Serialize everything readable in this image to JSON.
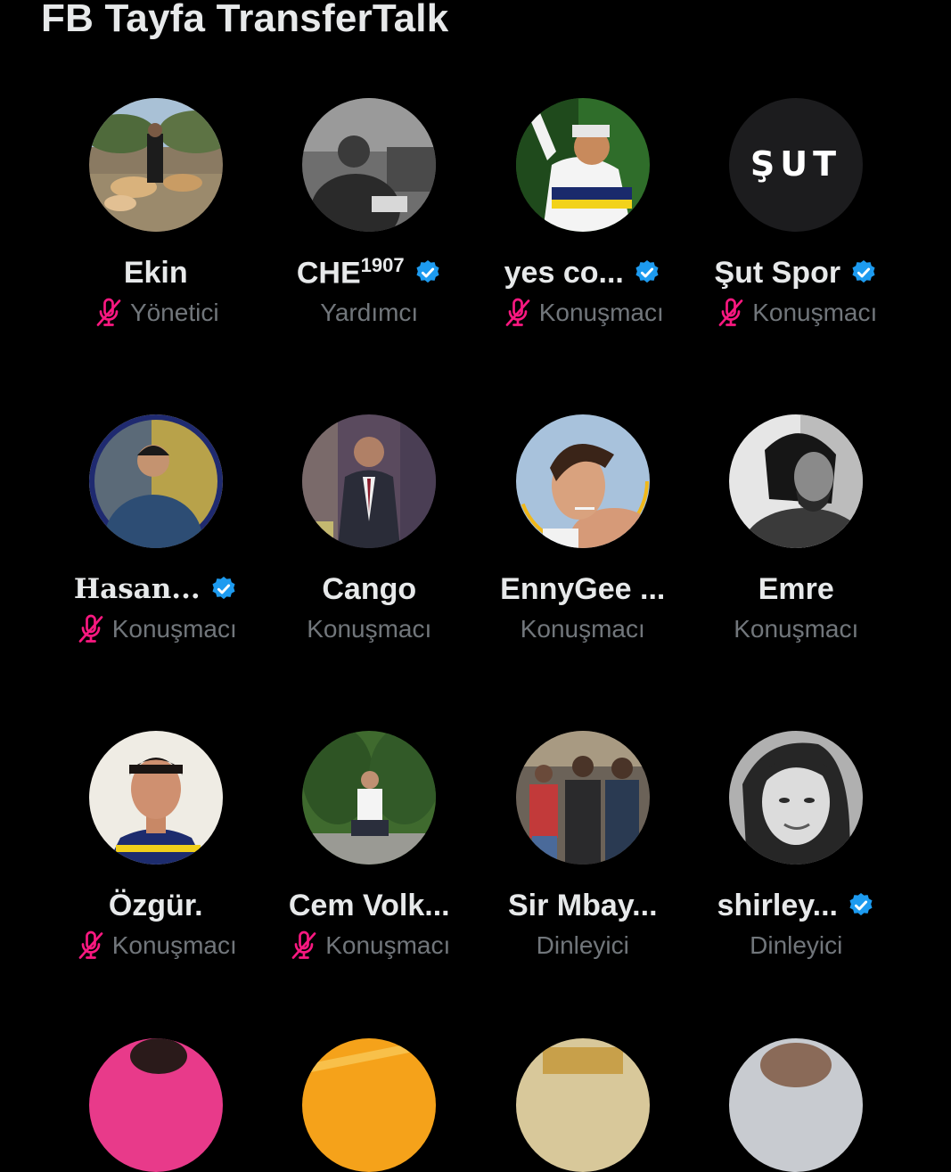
{
  "space": {
    "title": "FB Tayfa TransferTalk"
  },
  "participants": [
    {
      "name": "Ekin",
      "verified": false,
      "muted": true,
      "role": "Yönetici"
    },
    {
      "name": "CHE",
      "sup": "1907",
      "verified": true,
      "muted": false,
      "role": "Yardımcı"
    },
    {
      "name": "yes co...",
      "verified": true,
      "muted": true,
      "role": "Konuşmacı"
    },
    {
      "name": "Şut Spor",
      "verified": true,
      "muted": true,
      "role": "Konuşmacı"
    },
    {
      "name": "Hasan...",
      "verified": true,
      "muted": true,
      "role": "Konuşmacı"
    },
    {
      "name": "Cango",
      "verified": false,
      "muted": false,
      "role": "Konuşmacı"
    },
    {
      "name": "EnnyGee ...",
      "verified": false,
      "muted": false,
      "role": "Konuşmacı"
    },
    {
      "name": "Emre",
      "verified": false,
      "muted": false,
      "role": "Konuşmacı"
    },
    {
      "name": "Özgür.",
      "verified": false,
      "muted": true,
      "role": "Konuşmacı"
    },
    {
      "name": "Cem Volk...",
      "verified": false,
      "muted": true,
      "role": "Konuşmacı"
    },
    {
      "name": "Sir Mbay...",
      "verified": false,
      "muted": false,
      "role": "Dinleyici"
    },
    {
      "name": "shirley...",
      "verified": true,
      "muted": false,
      "role": "Dinleyici"
    }
  ],
  "logo_text": "ŞUT",
  "colors": {
    "background": "#000000",
    "name_text": "#e7e9ea",
    "role_text": "#71767b",
    "verified_badge": "#1d9bf0",
    "muted_mic": "#f91880"
  },
  "icons": {
    "verified": "verified-badge-icon",
    "muted": "mic-off-icon"
  }
}
